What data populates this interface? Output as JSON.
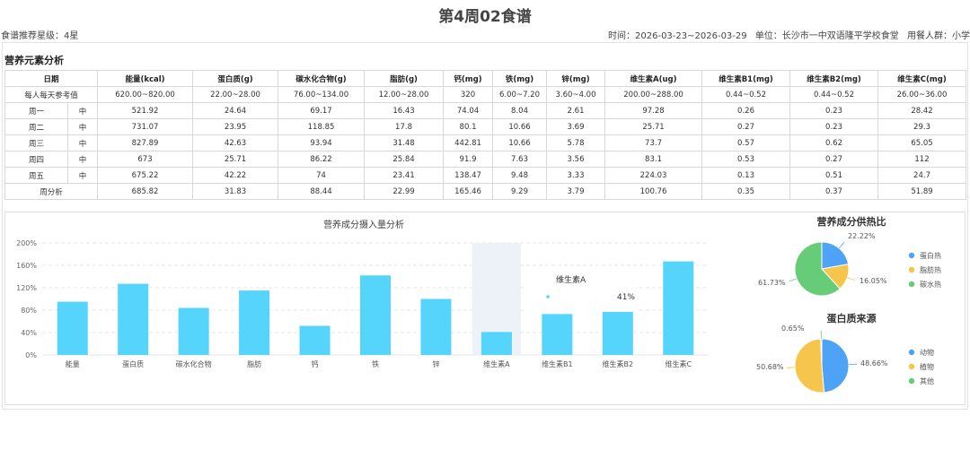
{
  "header": {
    "title": "第4周02食谱",
    "rating": "食谱推荐星级：4星",
    "time": "时间：2026-03-23~2026-03-29",
    "unit": "单位：长沙市一中双语隆平学校食堂",
    "audience": "用餐人群：小学"
  },
  "section_title": "营养元素分析",
  "table": {
    "headers": [
      "日期",
      "能量(kcal)",
      "蛋白质(g)",
      "碳水化合物(g)",
      "脂肪(g)",
      "钙(mg)",
      "铁(mg)",
      "锌(mg)",
      "维生素A(ug)",
      "维生素B1(mg)",
      "维生素B2(mg)",
      "维生素C(mg)"
    ],
    "reference": {
      "label": "每人每天参考值",
      "values": [
        "620.00~820.00",
        "22.00~28.00",
        "76.00~134.00",
        "12.00~28.00",
        "320",
        "6.00~7.20",
        "3.60~4.00",
        "200.00~288.00",
        "0.44~0.52",
        "0.44~0.52",
        "26.00~36.00"
      ]
    },
    "rows": [
      {
        "day": "周一",
        "meal": "中",
        "values": [
          "521.92",
          "24.64",
          "69.17",
          "16.43",
          "74.04",
          "8.04",
          "2.61",
          "97.28",
          "0.26",
          "0.23",
          "28.42"
        ]
      },
      {
        "day": "周二",
        "meal": "中",
        "values": [
          "731.07",
          "23.95",
          "118.85",
          "17.8",
          "80.1",
          "10.66",
          "3.69",
          "25.71",
          "0.27",
          "0.23",
          "29.3"
        ]
      },
      {
        "day": "周三",
        "meal": "中",
        "values": [
          "827.89",
          "42.63",
          "93.94",
          "31.48",
          "442.81",
          "10.66",
          "5.78",
          "73.7",
          "0.57",
          "0.62",
          "65.05"
        ]
      },
      {
        "day": "周四",
        "meal": "中",
        "values": [
          "673",
          "25.71",
          "86.22",
          "25.84",
          "91.9",
          "7.63",
          "3.56",
          "83.1",
          "0.53",
          "0.27",
          "112"
        ]
      },
      {
        "day": "周五",
        "meal": "中",
        "values": [
          "675.22",
          "42.22",
          "74",
          "23.41",
          "138.47",
          "9.48",
          "3.33",
          "224.03",
          "0.13",
          "0.51",
          "24.7"
        ]
      }
    ],
    "summary": {
      "label": "周分析",
      "values": [
        "685.82",
        "31.83",
        "88.44",
        "22.99",
        "165.46",
        "9.29",
        "3.79",
        "100.76",
        "0.35",
        "0.37",
        "51.89"
      ]
    }
  },
  "chart_data": [
    {
      "type": "bar",
      "title": "营养成分摄入量分析",
      "categories": [
        "能量",
        "蛋白质",
        "碳水化合物",
        "脂肪",
        "钙",
        "铁",
        "锌",
        "维生素A",
        "维生素B1",
        "维生素B2",
        "维生素C"
      ],
      "values": [
        95,
        127,
        84,
        115,
        52,
        142,
        100,
        41,
        73,
        77,
        167
      ],
      "ylim": [
        0,
        200
      ],
      "yticks": [
        "0%",
        "40%",
        "80%",
        "120%",
        "160%",
        "200%"
      ],
      "grid": true,
      "color": "#55d4fc",
      "tooltip": {
        "label": "维生素A",
        "value": "41%"
      }
    },
    {
      "type": "pie",
      "title": "营养成分供热比",
      "labels": [
        "蛋白热",
        "脂肪热",
        "碳水热"
      ],
      "values": [
        22.22,
        16.05,
        61.73
      ],
      "value_labels": [
        "22.22%",
        "16.05%",
        "61.73%"
      ],
      "colors": [
        "#4ea3f7",
        "#f6c54c",
        "#66cc77"
      ],
      "legend": "right"
    },
    {
      "type": "pie",
      "title": "蛋白质来源",
      "labels": [
        "动物",
        "植物",
        "其他"
      ],
      "values": [
        48.66,
        50.68,
        0.65
      ],
      "value_labels": [
        "48.66%",
        "50.68%",
        "0.65%"
      ],
      "colors": [
        "#4ea3f7",
        "#f6c54c",
        "#66cc77"
      ],
      "legend": "right"
    }
  ]
}
